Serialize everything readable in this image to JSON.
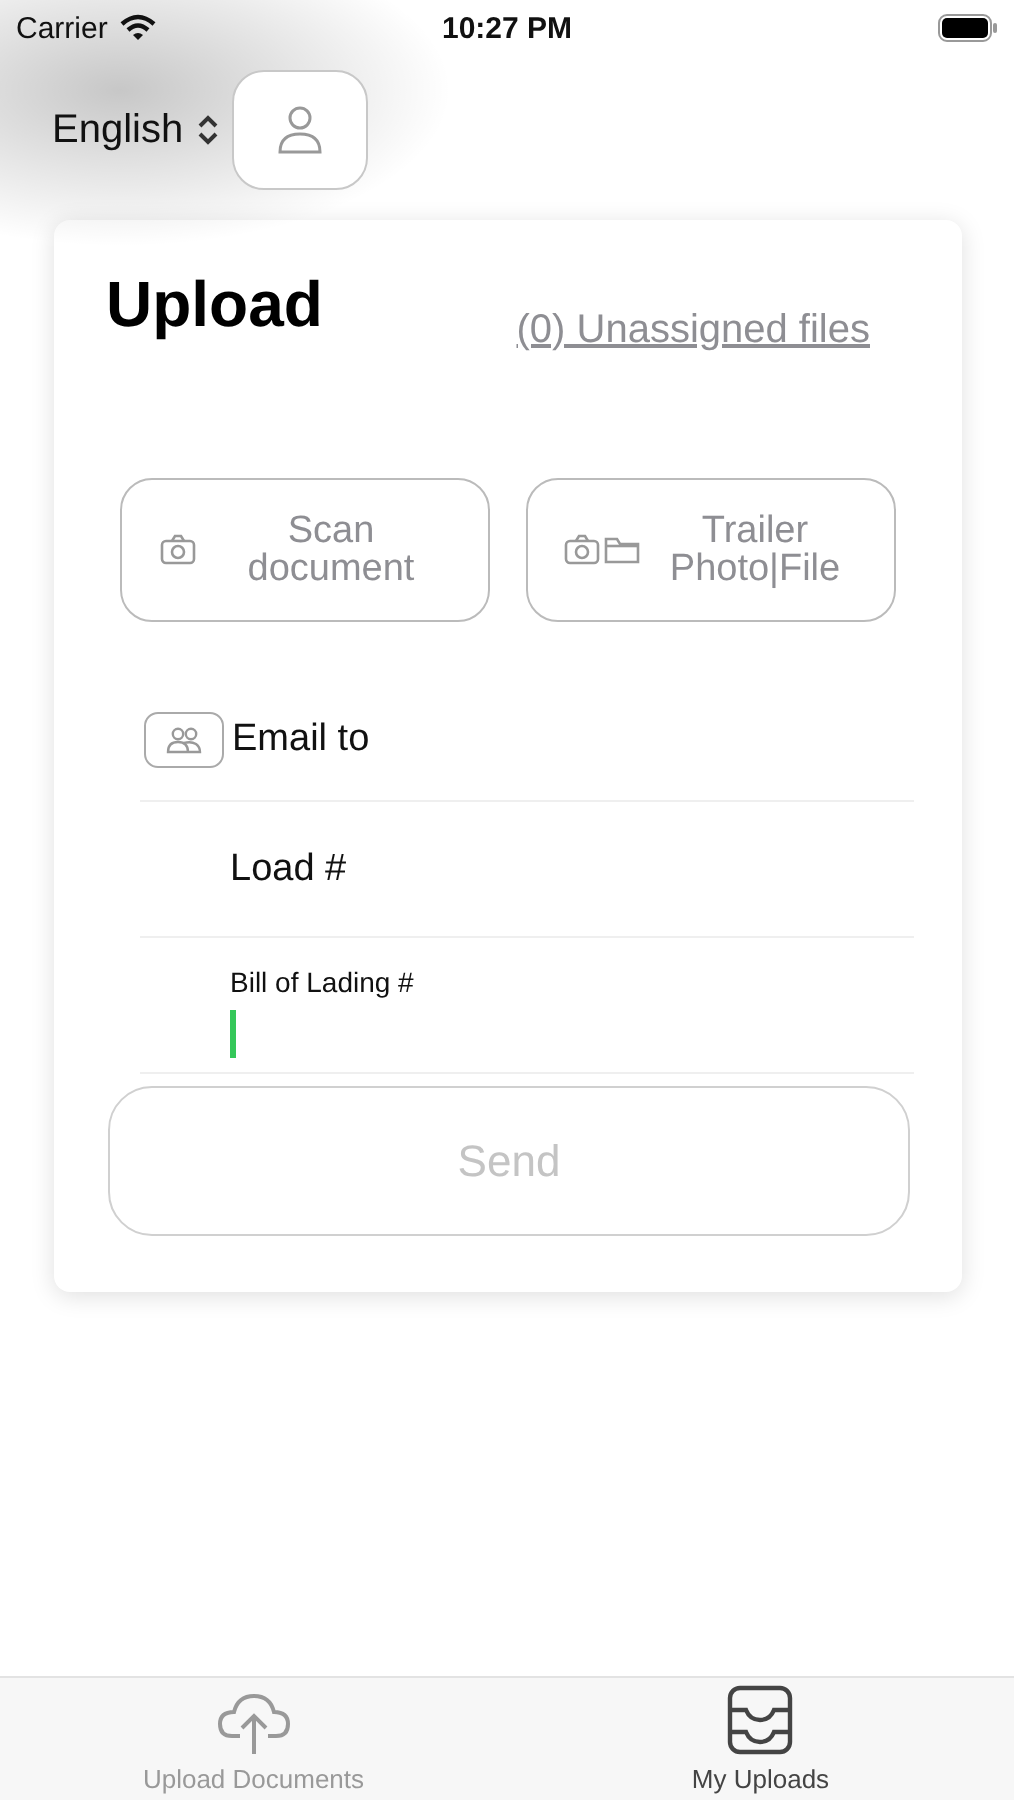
{
  "status_bar": {
    "carrier": "Carrier",
    "time": "10:27 PM"
  },
  "header": {
    "language": "English"
  },
  "upload": {
    "title": "Upload",
    "unassigned_link": "(0) Unassigned files",
    "actions": [
      {
        "kind": "camera",
        "label": "Scan document"
      },
      {
        "kind": "camera_folder",
        "label": "Trailer Photo|File"
      }
    ],
    "fields": [
      {
        "kind": "contact",
        "placeholder": "Email to"
      },
      {
        "kind": "plain",
        "placeholder": "Load #"
      },
      {
        "kind": "floating",
        "label": "Bill of Lading #",
        "focused": true
      }
    ],
    "send": {
      "label": "Send",
      "disabled": true
    }
  },
  "tabs": [
    {
      "kind": "upload",
      "label": "Upload Documents",
      "selected": false
    },
    {
      "kind": "inbox",
      "label": "My Uploads",
      "selected": true
    }
  ]
}
